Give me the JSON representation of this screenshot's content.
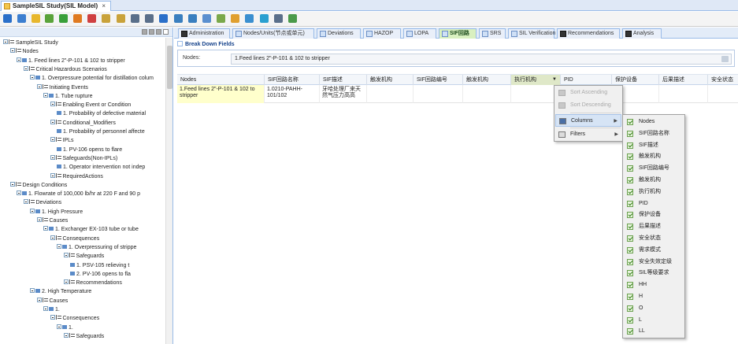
{
  "doc_tab": {
    "title": "SampleSIL Study(SIL Model)",
    "close": "×"
  },
  "toolbar_icons": [
    "save-icon",
    "print-icon",
    "folder-icon",
    "wand-icon",
    "add-icon",
    "tools-icon",
    "cut-icon",
    "copy-icon",
    "paste-icon",
    "up-arrow-icon",
    "down-arrow-icon",
    "export-icon",
    "tree-icon",
    "grid-icon",
    "table-icon",
    "chart-icon",
    "link-icon",
    "refresh-icon",
    "globe-icon",
    "dropdown-icon",
    "image-icon"
  ],
  "tree": {
    "nodes": [
      {
        "label": "SampleSIL Study",
        "level": 0,
        "kind": "root"
      },
      {
        "label": "Nodes",
        "level": 1,
        "kind": "folder"
      },
      {
        "label": "1. Feed lines 2\"-P-101 & 102 to stripper",
        "level": 2,
        "kind": "flag"
      },
      {
        "label": "Critical Hazardous Scenarios",
        "level": 3,
        "kind": "folder"
      },
      {
        "label": "1. Overpressure potential for distillation colum",
        "level": 4,
        "kind": "flag"
      },
      {
        "label": "Initiating Events",
        "level": 5,
        "kind": "folder"
      },
      {
        "label": "1. Tube rupture",
        "level": 6,
        "kind": "flag"
      },
      {
        "label": "Enabling Event or Condition",
        "level": 7,
        "kind": "folder"
      },
      {
        "label": "1. Probability of defective material",
        "level": 8,
        "kind": "leaf"
      },
      {
        "label": "Conditional_Modifiers",
        "level": 7,
        "kind": "folder"
      },
      {
        "label": "1. Probability of personnel affecte",
        "level": 8,
        "kind": "leaf"
      },
      {
        "label": "IPLs",
        "level": 7,
        "kind": "folder"
      },
      {
        "label": "1. PV-106 opens to flare",
        "level": 8,
        "kind": "leaf"
      },
      {
        "label": "Safeguards(Non-IPLs)",
        "level": 7,
        "kind": "folder"
      },
      {
        "label": "1. Operator intervention not indep",
        "level": 8,
        "kind": "leaf"
      },
      {
        "label": "RequiredActions",
        "level": 7,
        "kind": "folder"
      },
      {
        "label": "Design Conditions",
        "level": 1,
        "kind": "folder"
      },
      {
        "label": "1. Flowrate of 100,000 lb/hr at 220 F and 90 p",
        "level": 2,
        "kind": "flag"
      },
      {
        "label": "Deviations",
        "level": 3,
        "kind": "folder"
      },
      {
        "label": "1. High Pressure",
        "level": 4,
        "kind": "flag"
      },
      {
        "label": "Causes",
        "level": 5,
        "kind": "folder"
      },
      {
        "label": "1. Exchanger EX-103 tube or tube",
        "level": 6,
        "kind": "flag"
      },
      {
        "label": "Consequences",
        "level": 7,
        "kind": "folder"
      },
      {
        "label": "1. Overpressuring of strippe",
        "level": 8,
        "kind": "flag"
      },
      {
        "label": "Safeguards",
        "level": 9,
        "kind": "folder"
      },
      {
        "label": "1. PSV-105 relieving t",
        "level": 10,
        "kind": "leaf"
      },
      {
        "label": "2. PV-106 opens to fla",
        "level": 10,
        "kind": "leaf"
      },
      {
        "label": "Recommendations",
        "level": 9,
        "kind": "folder"
      },
      {
        "label": "2. High Temperature",
        "level": 4,
        "kind": "flag"
      },
      {
        "label": "Causes",
        "level": 5,
        "kind": "folder"
      },
      {
        "label": "1.",
        "level": 6,
        "kind": "flag"
      },
      {
        "label": "Consequences",
        "level": 7,
        "kind": "folder"
      },
      {
        "label": "1.",
        "level": 8,
        "kind": "flag"
      },
      {
        "label": "Safeguards",
        "level": 9,
        "kind": "folder"
      }
    ]
  },
  "right_tabs": [
    {
      "label": "Administration",
      "style": "dark"
    },
    {
      "label": "Nodes/Units(节点或单元)",
      "style": "light"
    },
    {
      "label": "Deviations",
      "style": "light"
    },
    {
      "label": "HAZOP",
      "style": "light"
    },
    {
      "label": "LOPA",
      "style": "light"
    },
    {
      "label": "SIF回路",
      "style": "active"
    },
    {
      "label": "SRS",
      "style": "light"
    },
    {
      "label": "SIL Verification",
      "style": "light"
    },
    {
      "label": "Recommendations",
      "style": "dark"
    },
    {
      "label": "Analysis",
      "style": "dark"
    }
  ],
  "breakdown": {
    "title": "Break Down Fields",
    "nodes_label": "Nodes:",
    "nodes_value": "1.Feed lines 2\"-P-101 & 102  to stripper"
  },
  "grid": {
    "columns": [
      "Nodes",
      "SIF回路名称",
      "SIF描述",
      "触发机构",
      "SIF回路编号",
      "触发机构",
      "执行机构",
      "PID",
      "保护设备",
      "后果描述",
      "安全状态"
    ],
    "sorted_indicator": "▼",
    "rows": [
      [
        "1.Feed lines 2\"-P-101 & 102 to stripper",
        "1.0210-PAHH-101/102",
        "牙哈处理厂来天然气压力高高",
        "",
        "",
        "",
        "",
        "",
        "",
        "",
        ""
      ]
    ]
  },
  "context_menu": {
    "items": [
      {
        "label": "Sort Ascending",
        "disabled": true,
        "icon": "sort-ascending-icon"
      },
      {
        "label": "Sort Descending",
        "disabled": true,
        "icon": "sort-descending-icon"
      },
      {
        "label": "Columns",
        "disabled": false,
        "icon": "columns-icon",
        "submenu": true,
        "highlighted": true
      },
      {
        "label": "Filters",
        "disabled": false,
        "icon": "filter-icon",
        "submenu": true
      }
    ],
    "submenu_arrow": "▶"
  },
  "columns_menu": {
    "items": [
      "Nodes",
      "SIF回路名称",
      "SIF描述",
      "触发机构",
      "SIF回路编号",
      "触发机构",
      "执行机构",
      "PID",
      "保护设备",
      "后果描述",
      "安全状态",
      "需求模式",
      "安全失效定级",
      "SIL等级要求",
      "HH",
      "H",
      "O",
      "L",
      "LL"
    ]
  },
  "colors": {
    "accent_blue": "#99bbe8",
    "active_tab": "#d9f0c0",
    "highlight_cell": "#ffffcc",
    "menu_bg": "#f0f0f0"
  }
}
